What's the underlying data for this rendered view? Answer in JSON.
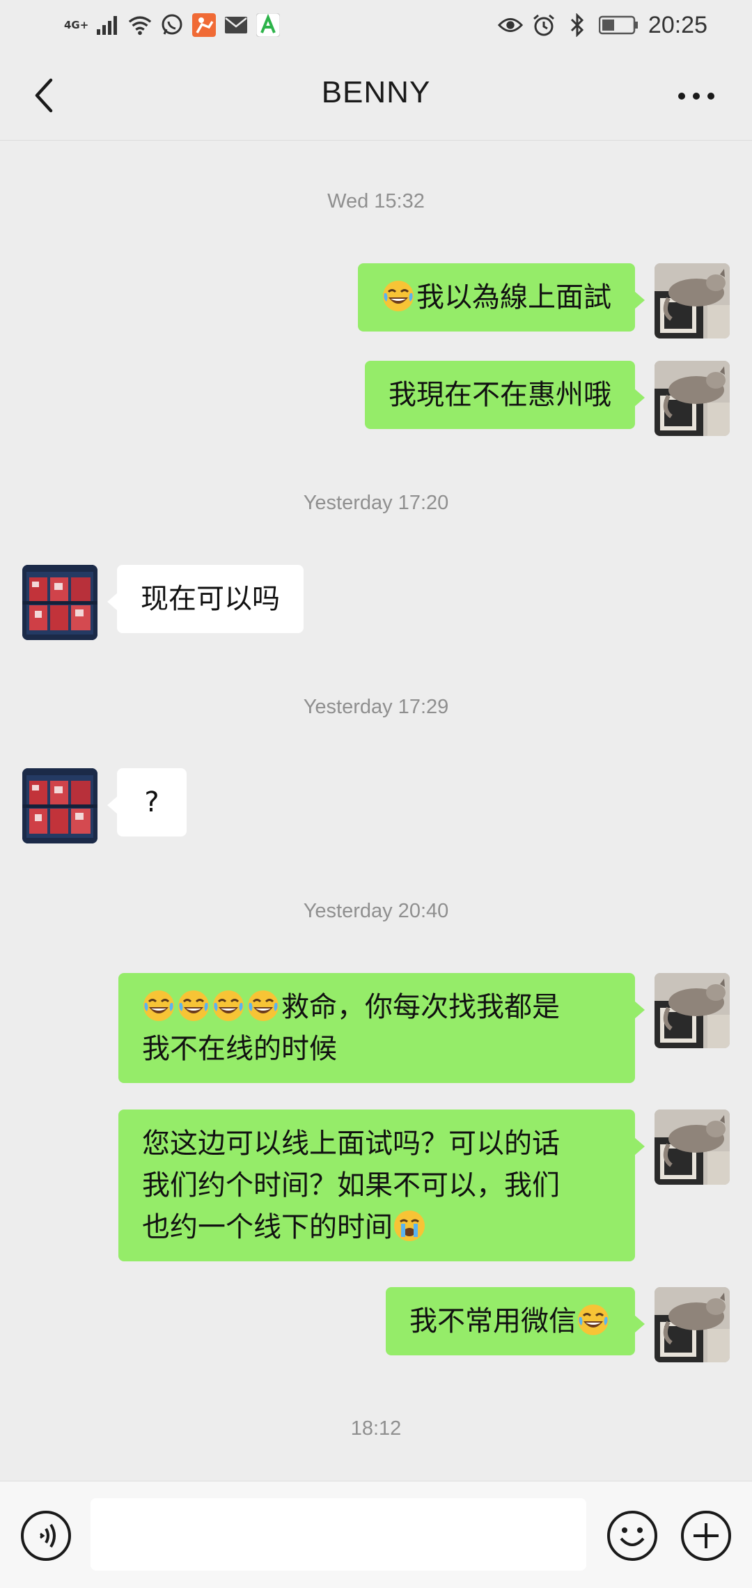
{
  "status_bar": {
    "network": "4G+",
    "time": "20:25"
  },
  "header": {
    "title": "BENNY"
  },
  "timestamps": [
    "Wed 15:32",
    "Yesterday 17:20",
    "Yesterday 17:29",
    "Yesterday 20:40",
    "18:12"
  ],
  "messages": [
    {
      "side": "sent",
      "emoji_prefix": 1,
      "text": "我以為線上面試"
    },
    {
      "side": "sent",
      "text": "我現在不在惠州哦"
    },
    {
      "side": "received",
      "text": "现在可以吗"
    },
    {
      "side": "received",
      "text": "?"
    },
    {
      "side": "sent",
      "emoji_prefix": 4,
      "lines": [
        "救命，你每次找我都是",
        "我不在线的时候"
      ]
    },
    {
      "side": "sent",
      "lines": [
        "您这边可以线上面试吗？可以的话",
        "我们约个时间？如果不可以，我们",
        "也约一个线下的时间"
      ],
      "emoji_suffix": "crying"
    },
    {
      "side": "sent",
      "text": "我不常用微信",
      "emoji_suffix": "laughing"
    }
  ],
  "input_bar": {
    "placeholder": ""
  },
  "colors": {
    "background": "#ededed",
    "sent_bubble": "#95ec69",
    "received_bubble": "#ffffff",
    "timestamp": "#8f8f8f"
  },
  "icons": [
    "back-icon",
    "more-icon",
    "voice-icon",
    "emoji-icon",
    "plus-icon",
    "laughing-emoji",
    "crying-emoji"
  ]
}
